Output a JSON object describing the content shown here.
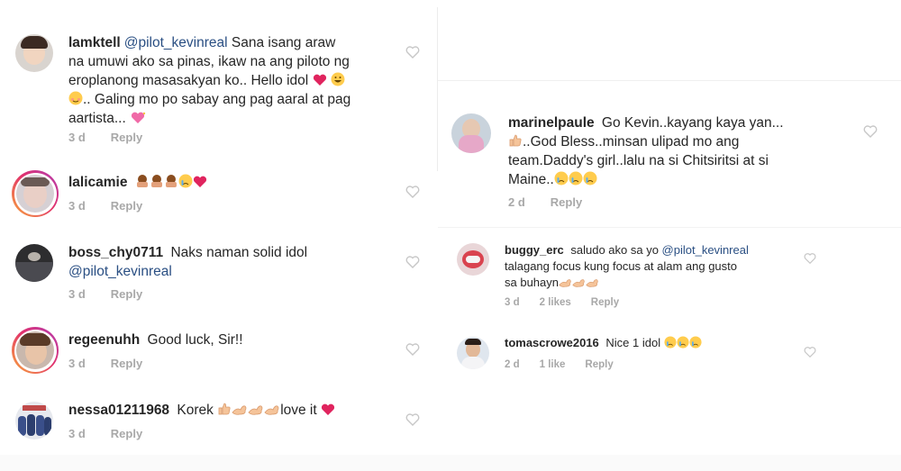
{
  "left": {
    "comments": [
      {
        "username": "lamktell",
        "mention": "@pilot_kevinreal",
        "text_a": " Sana isang araw",
        "line2": "na umuwi ako sa pinas, ikaw na ang piloto ng",
        "line3": "eroplanong masasakyan ko.. Hello idol",
        "line4": ".. Galing mo po sabay ang pag aaral at pag",
        "line5": "aartista...",
        "time": "3 d",
        "reply": "Reply"
      },
      {
        "username": "lalicamie",
        "time": "3 d",
        "reply": "Reply"
      },
      {
        "username": "boss_chy0711",
        "text": " Naks naman solid idol",
        "mention": "@pilot_kevinreal",
        "time": "3 d",
        "reply": "Reply"
      },
      {
        "username": "regeenuhh",
        "text": " Good luck, Sir!!",
        "time": "3 d",
        "reply": "Reply"
      },
      {
        "username": "nessa01211968",
        "text_a": " Korek",
        "text_b": "love it",
        "time": "3 d",
        "reply": "Reply"
      }
    ]
  },
  "right": {
    "comments": [
      {
        "username": "marinelpaule",
        "text": " Go Kevin..kayang kaya yan...",
        "line2": "..God Bless..minsan ulipad mo ang",
        "line3": "team.Daddy's girl..lalu na si Chitsiritsi at si",
        "line4": "Maine..",
        "time": "2 d",
        "reply": "Reply"
      },
      {
        "username": "buggy_erc",
        "text": " saludo ako sa yo ",
        "mention": "@pilot_kevinreal",
        "line2": "talagang focus kung focus at alam ang gusto",
        "line3": "sa buhayn",
        "time": "3 d",
        "likes": "2 likes",
        "reply": "Reply"
      },
      {
        "username": "tomascrowe2016",
        "text": " Nice 1 idol",
        "time": "2 d",
        "likes": "1 like",
        "reply": "Reply"
      }
    ]
  },
  "icons": {
    "heart": "heart-outline-icon",
    "heart_red": "red-heart-emoji",
    "pink_heart": "sparkling-heart-emoji",
    "clap": "clapping-hands-emoji",
    "muscle": "flexed-biceps-emoji",
    "thumbs": "thumbs-up-emoji",
    "cry": "crying-face-emoji",
    "bow": "person-bowing-emoji"
  },
  "colors": {
    "mention": "#2a4f83",
    "meta": "#a8a8a8",
    "heart_outline": "#c7c7c7",
    "emoji_red": "#e0245e"
  }
}
